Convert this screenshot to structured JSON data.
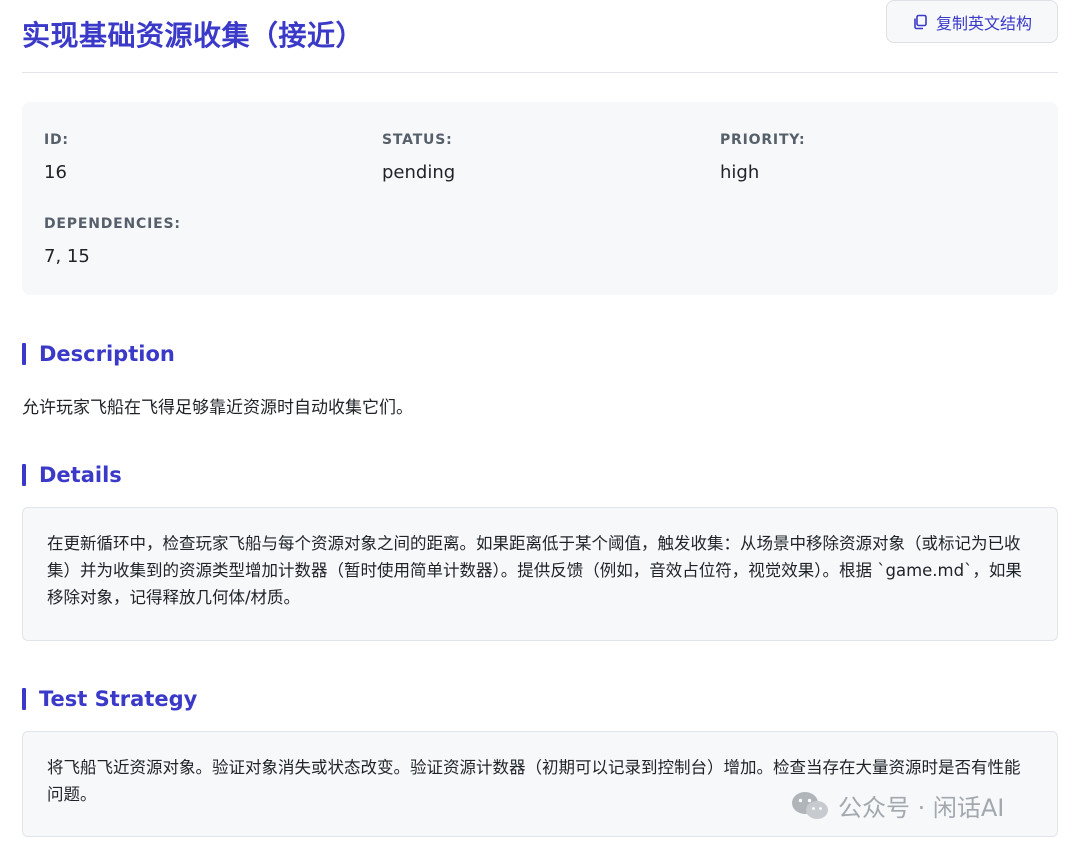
{
  "header": {
    "title": "实现基础资源收集（接近）",
    "copy_button_label": "复制英文结构",
    "copy_icon": "copy-icon"
  },
  "meta": {
    "id_label": "ID:",
    "id_value": "16",
    "status_label": "STATUS:",
    "status_value": "pending",
    "priority_label": "PRIORITY:",
    "priority_value": "high",
    "dependencies_label": "DEPENDENCIES:",
    "dependencies_value": "7, 15"
  },
  "description": {
    "heading": "Description",
    "text": "允许玩家飞船在飞得足够靠近资源时自动收集它们。"
  },
  "details": {
    "heading": "Details",
    "text": "在更新循环中，检查玩家飞船与每个资源对象之间的距离。如果距离低于某个阈值，触发收集：从场景中移除资源对象（或标记为已收集）并为收集到的资源类型增加计数器（暂时使用简单计数器）。提供反馈（例如，音效占位符，视觉效果）。根据 `game.md`，如果移除对象，记得释放几何体/材质。"
  },
  "test_strategy": {
    "heading": "Test Strategy",
    "text": "将飞船飞近资源对象。验证对象消失或状态改变。验证资源计数器（初期可以记录到控制台）增加。检查当存在大量资源时是否有性能问题。"
  },
  "watermark": {
    "icon": "wechat-icon",
    "text": "公众号 · 闲话AI"
  },
  "colors": {
    "accent": "#3a39c8",
    "panel_bg": "#f6f8fa",
    "label_gray": "#57606a"
  }
}
